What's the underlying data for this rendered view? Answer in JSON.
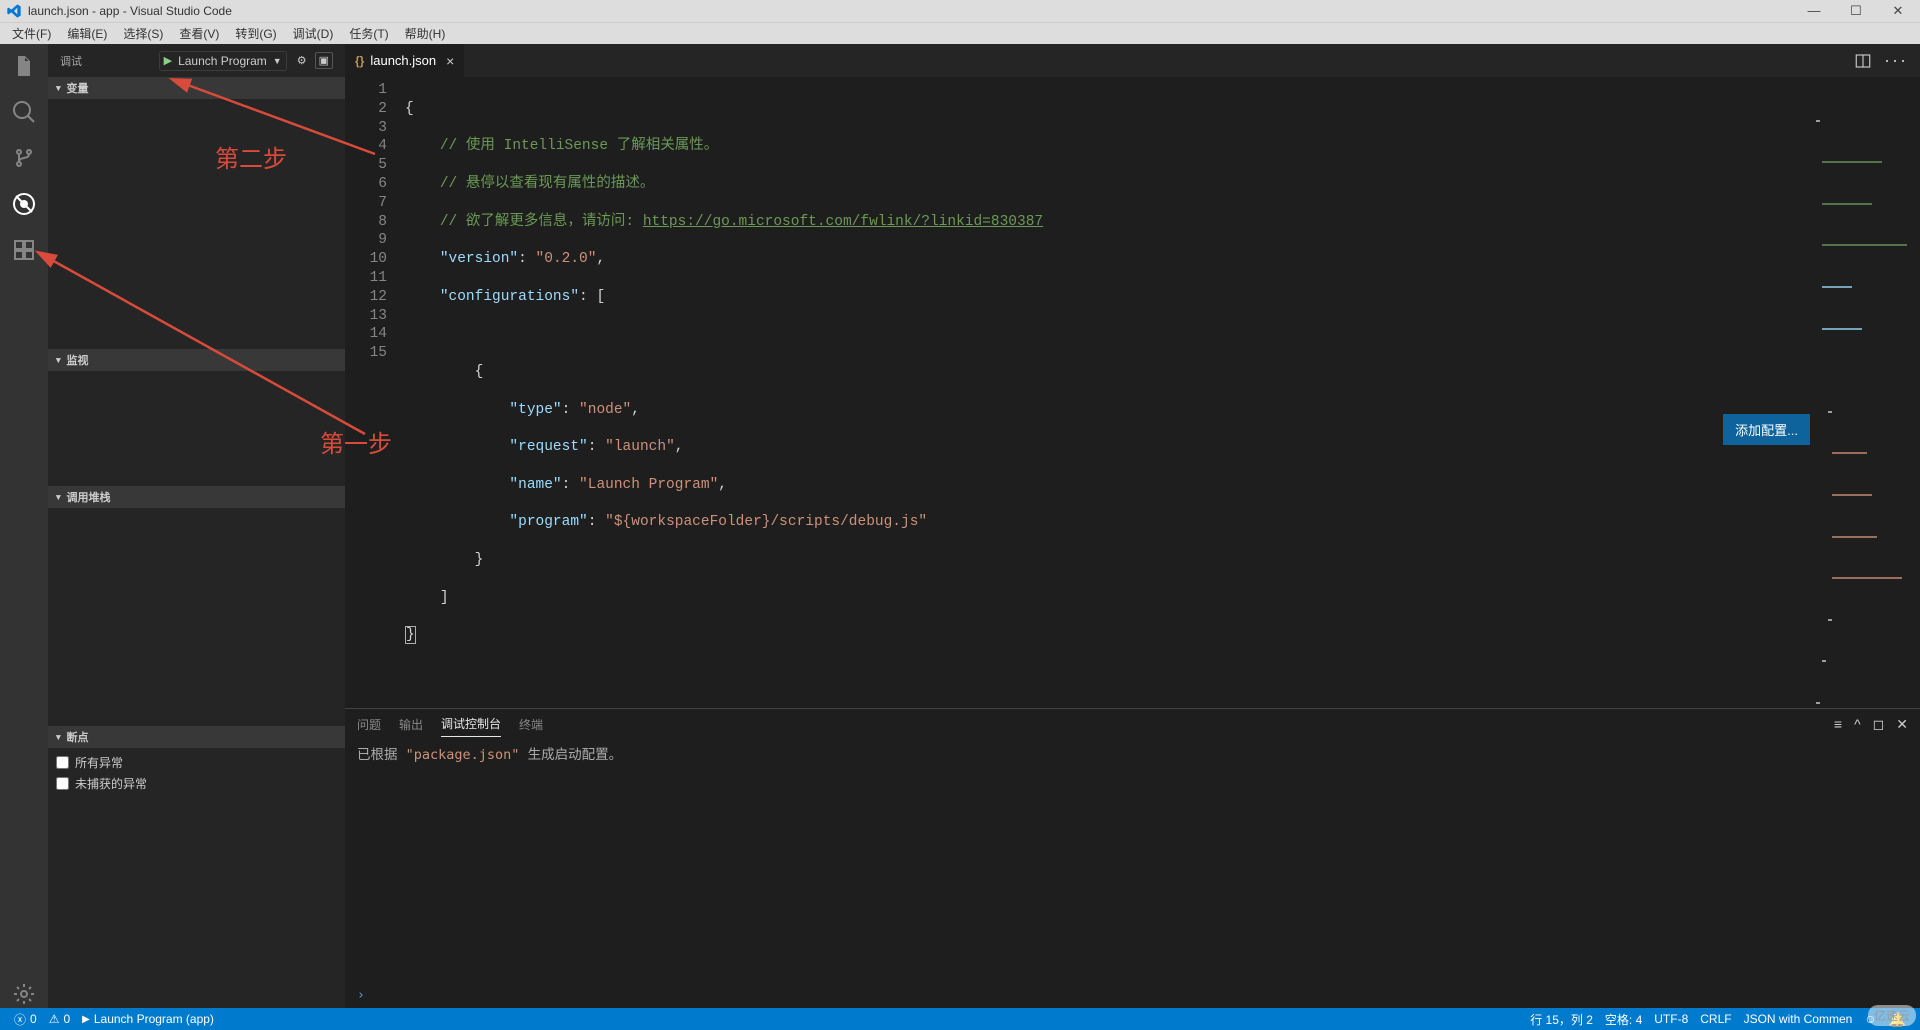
{
  "window": {
    "title": "launch.json - app - Visual Studio Code"
  },
  "menu": {
    "file": "文件(F)",
    "edit": "编辑(E)",
    "select": "选择(S)",
    "view": "查看(V)",
    "goto": "转到(G)",
    "debug": "调试(D)",
    "tasks": "任务(T)",
    "help": "帮助(H)"
  },
  "debugSidebar": {
    "title": "调试",
    "config": "Launch Program",
    "sections": {
      "variables": "变量",
      "watch": "监视",
      "callstack": "调用堆栈",
      "breakpoints": "断点"
    },
    "breakpoints": {
      "allExceptions": "所有异常",
      "uncaught": "未捕获的异常"
    }
  },
  "tab": {
    "name": "launch.json"
  },
  "editor": {
    "addConfig": "添加配置...",
    "line1": "{",
    "comment1": "// 使用 IntelliSense 了解相关属性。",
    "comment2": "// 悬停以查看现有属性的描述。",
    "comment3pre": "// 欲了解更多信息，请访问: ",
    "comment3link": "https://go.microsoft.com/fwlink/?linkid=830387",
    "versionKey": "\"version\"",
    "versionVal": "\"0.2.0\"",
    "configKey": "\"configurations\"",
    "typeKey": "\"type\"",
    "typeVal": "\"node\"",
    "requestKey": "\"request\"",
    "requestVal": "\"launch\"",
    "nameKey": "\"name\"",
    "nameVal": "\"Launch Program\"",
    "programKey": "\"program\"",
    "programVal": "\"${workspaceFolder}/scripts/debug.js\"",
    "lineNumbers": [
      "1",
      "2",
      "3",
      "4",
      "5",
      "6",
      "7",
      "8",
      "9",
      "10",
      "11",
      "12",
      "13",
      "14",
      "15"
    ]
  },
  "panel": {
    "tabs": {
      "problems": "问题",
      "output": "输出",
      "debugConsole": "调试控制台",
      "terminal": "终端"
    },
    "messagePre": "已根据 ",
    "messageStr": "\"package.json\"",
    "messagePost": " 生成启动配置。",
    "repl": "›"
  },
  "status": {
    "errors": "0",
    "warnings": "0",
    "launch": "Launch Program (app)",
    "lineCol": "行 15，列 2",
    "spaces": "空格: 4",
    "encoding": "UTF-8",
    "eol": "CRLF",
    "lang": "JSON with Commen"
  },
  "annotations": {
    "step1": "第一步",
    "step2": "第二步"
  },
  "watermark": "亿速云"
}
